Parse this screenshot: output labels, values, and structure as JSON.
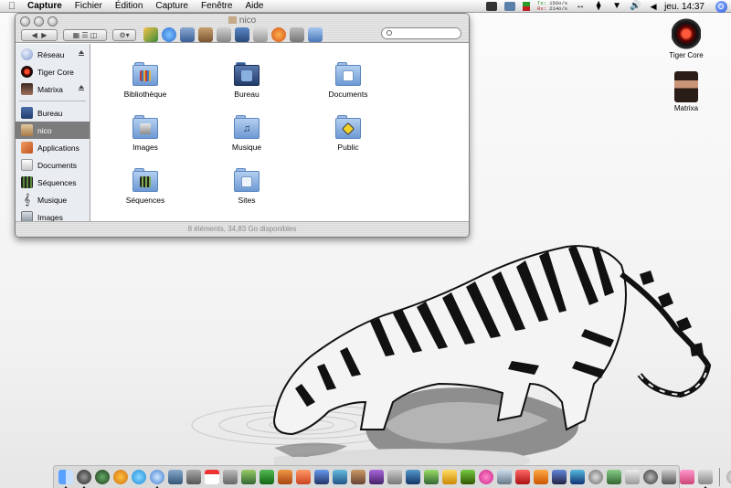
{
  "menubar": {
    "app_name": "Capture",
    "menus": [
      "Fichier",
      "Édition",
      "Capture",
      "Fenêtre",
      "Aide"
    ],
    "net_tx_label": "Tx:",
    "net_rx_label": "Rx:",
    "net_tx_value": "156o/s",
    "net_rx_value": "214o/s",
    "clock": "jeu. 14:37"
  },
  "window": {
    "title": "nico",
    "status": "8 éléments, 34,83 Go disponibles"
  },
  "sidebar": {
    "devices": [
      {
        "label": "Réseau",
        "icon": "network-globe-icon",
        "eject": true
      },
      {
        "label": "Tiger Core",
        "icon": "hal-eye-icon",
        "eject": false
      },
      {
        "label": "Matrixa",
        "icon": "matrixa-user-icon",
        "eject": true
      }
    ],
    "places": [
      {
        "label": "Bureau",
        "icon": "desktop-icon",
        "selected": false
      },
      {
        "label": "nico",
        "icon": "home-icon",
        "selected": true
      },
      {
        "label": "Applications",
        "icon": "applications-icon",
        "selected": false
      },
      {
        "label": "Documents",
        "icon": "documents-icon",
        "selected": false
      },
      {
        "label": "Séquences",
        "icon": "movies-icon",
        "selected": false
      },
      {
        "label": "Musique",
        "icon": "music-icon",
        "selected": false
      },
      {
        "label": "Images",
        "icon": "pictures-icon",
        "selected": false
      }
    ]
  },
  "files": [
    {
      "label": "Bibliothèque",
      "icon": "library-folder-icon"
    },
    {
      "label": "Bureau",
      "icon": "desktop-folder-icon"
    },
    {
      "label": "Documents",
      "icon": "documents-folder-icon"
    },
    {
      "label": "Images",
      "icon": "pictures-folder-icon"
    },
    {
      "label": "Musique",
      "icon": "music-folder-icon"
    },
    {
      "label": "Public",
      "icon": "public-folder-icon"
    },
    {
      "label": "Séquences",
      "icon": "movies-folder-icon"
    },
    {
      "label": "Sites",
      "icon": "sites-folder-icon"
    }
  ],
  "desktop_icons": [
    {
      "label": "Tiger Core",
      "icon": "hal-eye-drive-icon"
    },
    {
      "label": "Matrixa",
      "icon": "matrixa-drive-icon"
    }
  ],
  "colors": {
    "selection": "#7c7c7c",
    "sidebar_bg": "#e9edf2",
    "folder_blue": "#6d99d4",
    "tx": "#0a8a0a",
    "rx": "#c02020"
  }
}
